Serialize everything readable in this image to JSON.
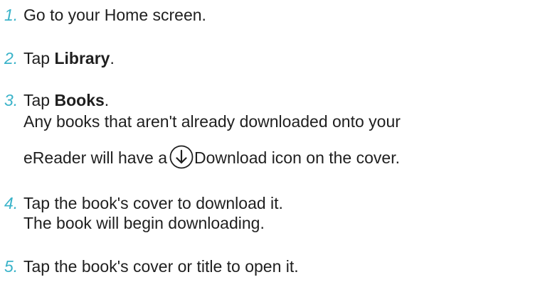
{
  "steps": [
    {
      "num": "1.",
      "text": "Go to your Home screen."
    },
    {
      "num": "2.",
      "prefix": "Tap ",
      "bold": "Library",
      "suffix": "."
    },
    {
      "num": "3.",
      "prefix": "Tap ",
      "bold": "Books",
      "suffix": ".",
      "note_line1": "Any books that aren't already downloaded onto your",
      "note_line2_before": "eReader will have a",
      "note_line2_after": "Download icon on the cover."
    },
    {
      "num": "4.",
      "text": "Tap the book's cover to download it.",
      "note": "The book will begin downloading."
    },
    {
      "num": "5.",
      "text": "Tap the book's cover or title to open it."
    }
  ],
  "icons": {
    "download": "download-arrow-circle-icon"
  },
  "colors": {
    "number_accent": "#3ab3c9",
    "text": "#1f1f1f"
  }
}
